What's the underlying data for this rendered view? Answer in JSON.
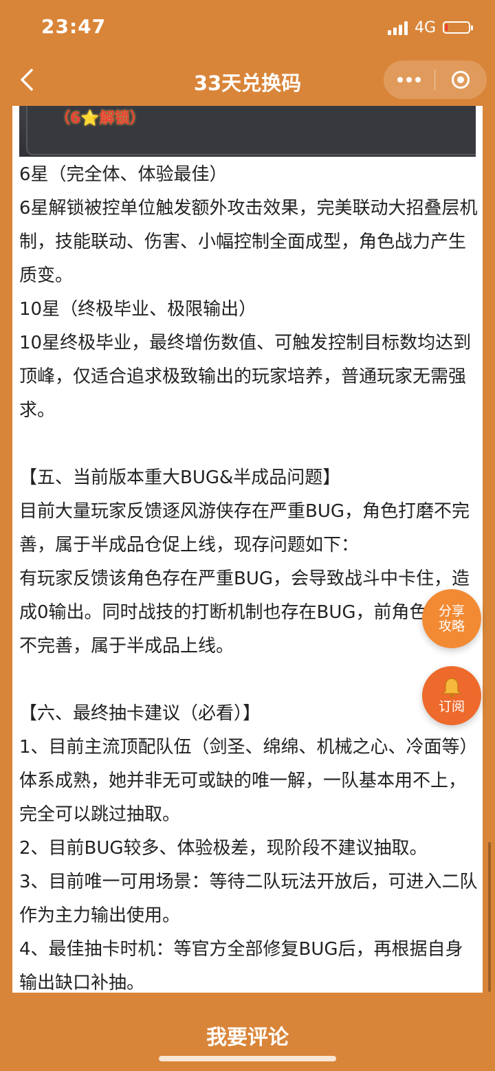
{
  "status_bar": {
    "time": "23:47",
    "network": "4G",
    "battery_level_fraction": 0.1
  },
  "nav": {
    "title": "33天兑换码",
    "back_icon": "chevron-left-icon",
    "more_icon": "more-dots-icon",
    "close_icon": "target-close-icon"
  },
  "article": {
    "image_caption": "（6⭐解锁）",
    "lines_1": [
      "6星（完全体、体验最佳）",
      "6星解锁被控单位触发额外攻击效果，完美联动大招叠层机制，技能联动、伤害、小幅控制全面成型，角色战力产生质变。",
      "10星（终极毕业、极限输出）",
      "10星终极毕业，最终增伤数值、可触发控制目标数均达到顶峰，仅适合追求极致输出的玩家培养，普通玩家无需强求。"
    ],
    "lines_2": [
      "【五、当前版本重大BUG&半成品问题】",
      "目前大量玩家反馈逐风游侠存在严重BUG，角色打磨不完善，属于半成品仓促上线，现存问题如下：",
      "有玩家反馈该角色存在严重BUG，会导致战斗中卡住，造成0输出。同时战技的打断机制也存在BUG，前角色打磨不完善，属于半成品上线。"
    ],
    "lines_3": [
      "【六、最终抽卡建议（必看）】",
      "1、目前主流顶配队伍（剑圣、绵绵、机械之心、冷面等）体系成熟，她并非无可或缺的唯一解，一队基本用不上，完全可以跳过抽取。",
      "2、目前BUG较多、体验极差，现阶段不建议抽取。",
      "3、目前唯一可用场景：等待二队玩法开放后，可进入二队作为主力输出使用。",
      "4、最佳抽卡时机：等官方全部修复BUG后，再根据自身输出缺口补抽。"
    ]
  },
  "floating": {
    "share_line1": "分享",
    "share_line2": "攻略",
    "subscribe_label": "订阅",
    "subscribe_icon": "bell-icon"
  },
  "bottom": {
    "comment_label": "我要评论"
  },
  "colors": {
    "brand": "#d98539",
    "fab": "#f28a34",
    "fab_subscribe": "#ed6a2c"
  }
}
